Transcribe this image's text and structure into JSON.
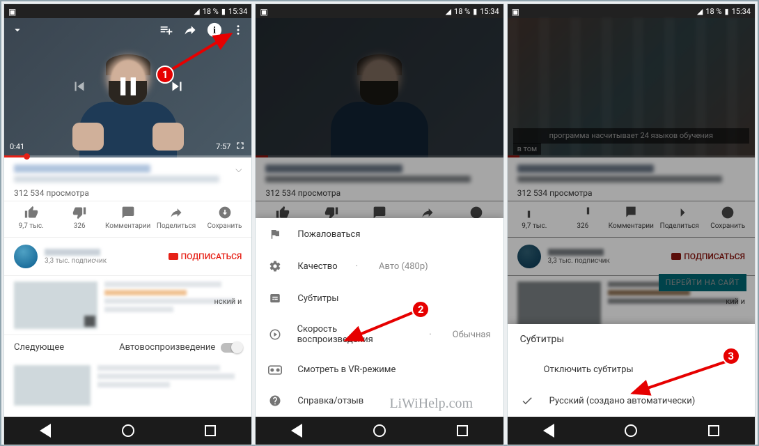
{
  "statusbar": {
    "battery_pct": "18 %",
    "time": "15:34"
  },
  "player": {
    "current_time": "0:41",
    "duration": "7:57"
  },
  "meta": {
    "views": "312 534 просмотра"
  },
  "actions": {
    "like_count": "9,7 тыс.",
    "dislike_count": "326",
    "comments_label": "Комментарии",
    "share_label": "Поделиться",
    "save_label": "Сохранить"
  },
  "channel": {
    "subscribers": "3,3 тыс. подписчик",
    "subscribe_label": "ПОДПИСАТЬСЯ"
  },
  "next": {
    "label": "Следующее",
    "autoplay_label": "Автовоспроизведение"
  },
  "suggestion_tail": "нский и",
  "menu": {
    "report": "Пожаловаться",
    "quality": "Качество",
    "quality_value": "Авто (480p)",
    "captions": "Субтитры",
    "speed": "Скорость воспроизведения",
    "speed_value": "Обычная",
    "vr": "Смотреть в VR-режиме",
    "help": "Справка/отзыв"
  },
  "captions_sheet": {
    "header": "Субтитры",
    "off": "Отключить субтитры",
    "ru": "Русский (создано автоматически)"
  },
  "overlay_caption": {
    "line1": "программа насчитывает 24 языков обучения",
    "line2": "в том"
  },
  "cta_label": "ПЕРЕЙТИ НА САЙТ",
  "suggestion2_tail": "кий и",
  "badges": {
    "one": "1",
    "two": "2",
    "three": "3"
  },
  "watermark": "LiWiHelp.com"
}
